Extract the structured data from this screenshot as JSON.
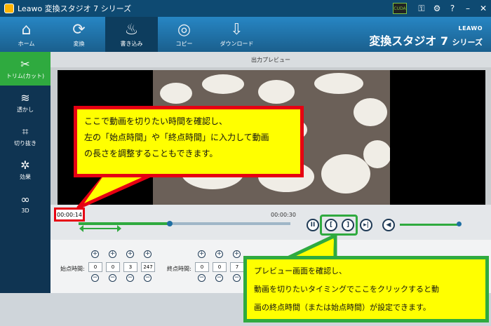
{
  "window": {
    "title": "Leawo 変換スタジオ 7 シリーズ",
    "cuda_badge": "CUDA"
  },
  "brand": {
    "company": "LEAWO",
    "product": "変換スタジオ 7",
    "suffix": "シリーズ"
  },
  "topnav": [
    {
      "label": "ホーム",
      "icon": "home-icon",
      "glyph": "⌂"
    },
    {
      "label": "変換",
      "icon": "convert-icon",
      "glyph": "⟳"
    },
    {
      "label": "書き込み",
      "icon": "burn-icon",
      "glyph": "🔥"
    },
    {
      "label": "コピー",
      "icon": "disc-icon",
      "glyph": "◎"
    },
    {
      "label": "ダウンロード",
      "icon": "download-icon",
      "glyph": "⇩"
    }
  ],
  "sidebar": [
    {
      "label": "トリム(カット)",
      "icon": "scissors-icon",
      "glyph": "✂"
    },
    {
      "label": "透かし",
      "icon": "watermark-icon",
      "glyph": "≋"
    },
    {
      "label": "切り抜き",
      "icon": "crop-icon",
      "glyph": "⌗"
    },
    {
      "label": "効果",
      "icon": "effect-icon",
      "glyph": "✲"
    },
    {
      "label": "3D",
      "icon": "3d-glasses-icon",
      "glyph": "∞"
    }
  ],
  "preview": {
    "header": "出力プレビュー"
  },
  "timeline": {
    "current_time": "00:00:14",
    "end_time": "00:00:30",
    "progress": 0.43,
    "volume": 1.0
  },
  "start_time": {
    "label": "始点時間:",
    "fields": [
      "0",
      "0",
      "3",
      "247"
    ]
  },
  "end_time": {
    "label": "終点時間:",
    "fields": [
      "0",
      "0",
      "7"
    ]
  },
  "callout_red": [
    "ここで動画を切りたい時間を確認し、",
    "左の「始点時間」や「終点時間」に入力して動画",
    "の長さを調整することもできます。"
  ],
  "callout_green": [
    "プレビュー画面を確認し、",
    "動画を切りたいタイミングでここをクリックすると動",
    "画の終点時間（または始点時間）が設定できます。"
  ],
  "colors": {
    "accent_green": "#2faa3f",
    "accent_red": "#e60012",
    "nav_blue": "#1e6fa3",
    "callout_yellow": "#ffff00"
  }
}
